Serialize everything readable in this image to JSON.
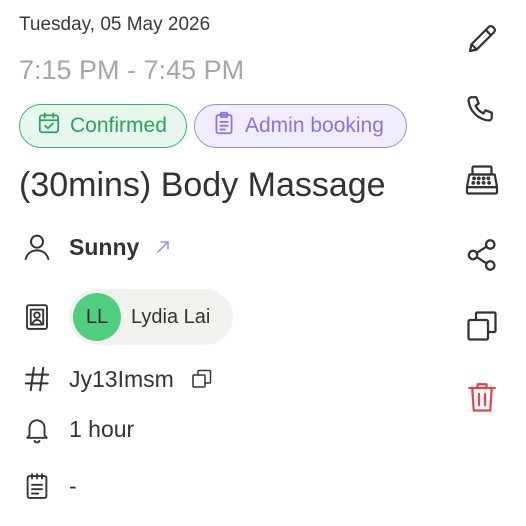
{
  "booking": {
    "date": "Tuesday, 05 May 2026",
    "time_range": "7:15 PM - 7:45 PM",
    "title": "(30mins) Body Massage",
    "status_label": "Confirmed",
    "source_label": "Admin booking",
    "customer_name": "Sunny",
    "staff": {
      "initials": "LL",
      "name": "Lydia Lai"
    },
    "reference": "Jy13Imsm",
    "reminder": "1 hour",
    "notes": "-"
  },
  "icons": {
    "status": "calendar-check-icon",
    "source": "clipboard-icon",
    "customer": "user-icon",
    "customer_link": "external-link-arrow-icon",
    "staff": "contact-badge-icon",
    "reference": "hash-icon",
    "reference_copy": "copy-icon",
    "reminder": "bell-icon",
    "notes": "notes-icon"
  },
  "actions": [
    {
      "id": "edit",
      "icon": "pencil-icon"
    },
    {
      "id": "call",
      "icon": "phone-icon"
    },
    {
      "id": "checkout",
      "icon": "cash-register-icon"
    },
    {
      "id": "share",
      "icon": "share-icon"
    },
    {
      "id": "duplicate",
      "icon": "duplicate-icon"
    },
    {
      "id": "delete",
      "icon": "trash-icon"
    }
  ],
  "colors": {
    "confirmed": "#27a35c",
    "admin": "#8a73e0",
    "avatar": "#4fcf7e",
    "danger": "#e0474c",
    "text": "#333333",
    "muted": "#a6a6a6"
  }
}
